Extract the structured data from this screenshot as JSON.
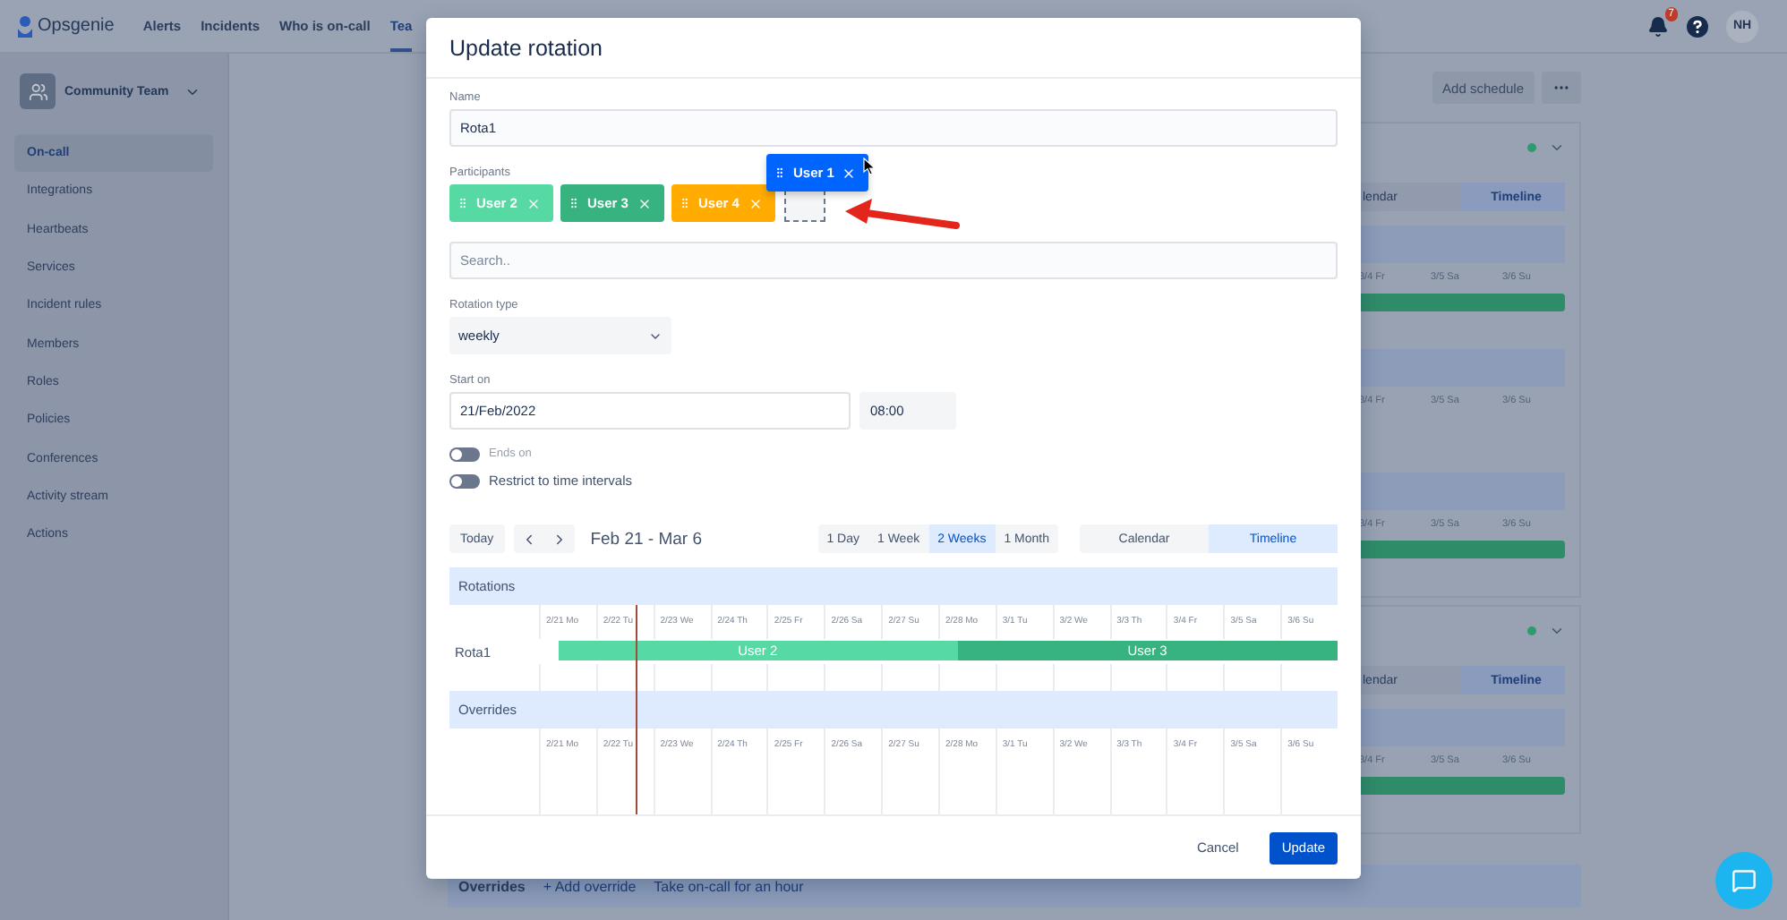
{
  "top_nav": {
    "logo": "Opsgenie",
    "items": [
      {
        "label": "Alerts",
        "selected": false
      },
      {
        "label": "Incidents",
        "selected": false
      },
      {
        "label": "Who is on-call",
        "selected": false
      },
      {
        "label": "Tea",
        "selected": true
      }
    ],
    "notification_count": "7",
    "avatar": "NH"
  },
  "sidebar": {
    "team": "Community Team",
    "items": [
      {
        "label": "On-call",
        "selected": true
      },
      {
        "label": "Integrations",
        "selected": false
      },
      {
        "label": "Heartbeats",
        "selected": false
      },
      {
        "label": "Services",
        "selected": false
      },
      {
        "label": "Incident rules",
        "selected": false
      },
      {
        "label": "Members",
        "selected": false
      },
      {
        "label": "Roles",
        "selected": false
      },
      {
        "label": "Policies",
        "selected": false
      },
      {
        "label": "Conferences",
        "selected": false
      },
      {
        "label": "Activity stream",
        "selected": false
      },
      {
        "label": "Actions",
        "selected": false
      }
    ]
  },
  "background": {
    "add_schedule": "Add schedule",
    "schedules": [
      {
        "views": [
          {
            "label": "lendar",
            "selected": false
          },
          {
            "label": "Timeline",
            "selected": true
          }
        ],
        "sections": [
          {
            "days": [
              "3/4 Fr",
              "3/5 Sa",
              "3/6 Su"
            ],
            "has_bar": true
          },
          {
            "days": [
              "3/4 Fr",
              "3/5 Sa",
              "3/6 Su"
            ],
            "has_bar": false
          },
          {
            "days": [
              "3/4 Fr",
              "3/5 Sa",
              "3/6 Su"
            ],
            "has_bar": true
          }
        ]
      },
      {
        "views": [
          {
            "label": "lendar",
            "selected": false
          },
          {
            "label": "Timeline",
            "selected": true
          }
        ],
        "sections": [
          {
            "days": [
              "3/4 Fr",
              "3/5 Sa",
              "3/6 Su"
            ],
            "has_bar": true
          }
        ]
      }
    ],
    "overrides_bar": {
      "title": "Overrides",
      "links": [
        "+ Add override",
        "Take on-call for an hour"
      ]
    }
  },
  "modal": {
    "title": "Update rotation",
    "name": {
      "label": "Name",
      "value": "Rota1"
    },
    "participants": {
      "label": "Participants",
      "chips": [
        {
          "name": "User 2",
          "color": "#57d9a3"
        },
        {
          "name": "User 3",
          "color": "#36b37e"
        },
        {
          "name": "User 4",
          "color": "#ffab00"
        }
      ],
      "dragging": {
        "name": "User 1",
        "color": "#0065ff"
      }
    },
    "search": {
      "placeholder": "Search.."
    },
    "rotation_type": {
      "label": "Rotation type",
      "value": "weekly"
    },
    "start_on": {
      "label": "Start on",
      "date": "21/Feb/2022",
      "time": "08:00"
    },
    "toggles": [
      {
        "label": "Ends on",
        "on": false,
        "disabled": true
      },
      {
        "label": "Restrict to time intervals",
        "on": false,
        "disabled": false
      }
    ],
    "toolbar": {
      "today": "Today",
      "range": "Feb 21 - Mar 6",
      "spans": [
        {
          "label": "1 Day",
          "selected": false
        },
        {
          "label": "1 Week",
          "selected": false
        },
        {
          "label": "2 Weeks",
          "selected": true
        },
        {
          "label": "1 Month",
          "selected": false
        }
      ],
      "views": [
        {
          "label": "Calendar",
          "selected": false
        },
        {
          "label": "Timeline",
          "selected": true
        }
      ]
    },
    "timeline": {
      "sections": [
        {
          "title": "Rotations",
          "days": [
            "2/21 Mo",
            "2/22 Tu",
            "2/23 We",
            "2/24 Th",
            "2/25 Fr",
            "2/26 Sa",
            "2/27 Su",
            "2/28 Mo",
            "3/1 Tu",
            "3/2 We",
            "3/3 Th",
            "3/4 Fr",
            "3/5 Sa",
            "3/6 Su"
          ],
          "rows": [
            {
              "name": "Rota1",
              "segments": [
                {
                  "user": "User 2",
                  "color": "#57d9a3"
                },
                {
                  "user": "User 3",
                  "color": "#36b37e"
                }
              ]
            }
          ]
        },
        {
          "title": "Overrides",
          "days": [
            "2/21 Mo",
            "2/22 Tu",
            "2/23 We",
            "2/24 Th",
            "2/25 Fr",
            "2/26 Sa",
            "2/27 Su",
            "2/28 Mo",
            "3/1 Tu",
            "3/2 We",
            "3/3 Th",
            "3/4 Fr",
            "3/5 Sa",
            "3/6 Su"
          ]
        }
      ]
    },
    "buttons": [
      {
        "label": "Cancel",
        "kind": "secondary"
      },
      {
        "label": "Update",
        "kind": "primary"
      }
    ]
  }
}
